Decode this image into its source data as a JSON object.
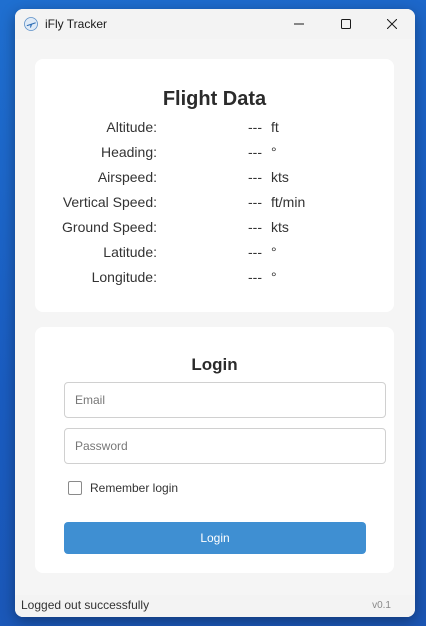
{
  "window": {
    "title": "iFly Tracker",
    "icon": "airplane-icon"
  },
  "flight_data": {
    "title": "Flight Data",
    "rows": [
      {
        "label": "Altitude:",
        "value": "---",
        "unit": "ft"
      },
      {
        "label": "Heading:",
        "value": "---",
        "unit": "°"
      },
      {
        "label": "Airspeed:",
        "value": "---",
        "unit": "kts"
      },
      {
        "label": "Vertical Speed:",
        "value": "---",
        "unit": "ft/min"
      },
      {
        "label": "Ground Speed:",
        "value": "---",
        "unit": "kts"
      },
      {
        "label": "Latitude:",
        "value": "---",
        "unit": "°"
      },
      {
        "label": "Longitude:",
        "value": "---",
        "unit": "°"
      }
    ]
  },
  "login": {
    "title": "Login",
    "email_placeholder": "Email",
    "email_value": "",
    "password_placeholder": "Password",
    "password_value": "",
    "remember_label": "Remember login",
    "remember_checked": false,
    "button_label": "Login"
  },
  "status": {
    "message": "Logged out successfully",
    "version": "v0.1"
  },
  "colors": {
    "accent": "#3f8fd2",
    "desktop": "#1a5cc0"
  }
}
